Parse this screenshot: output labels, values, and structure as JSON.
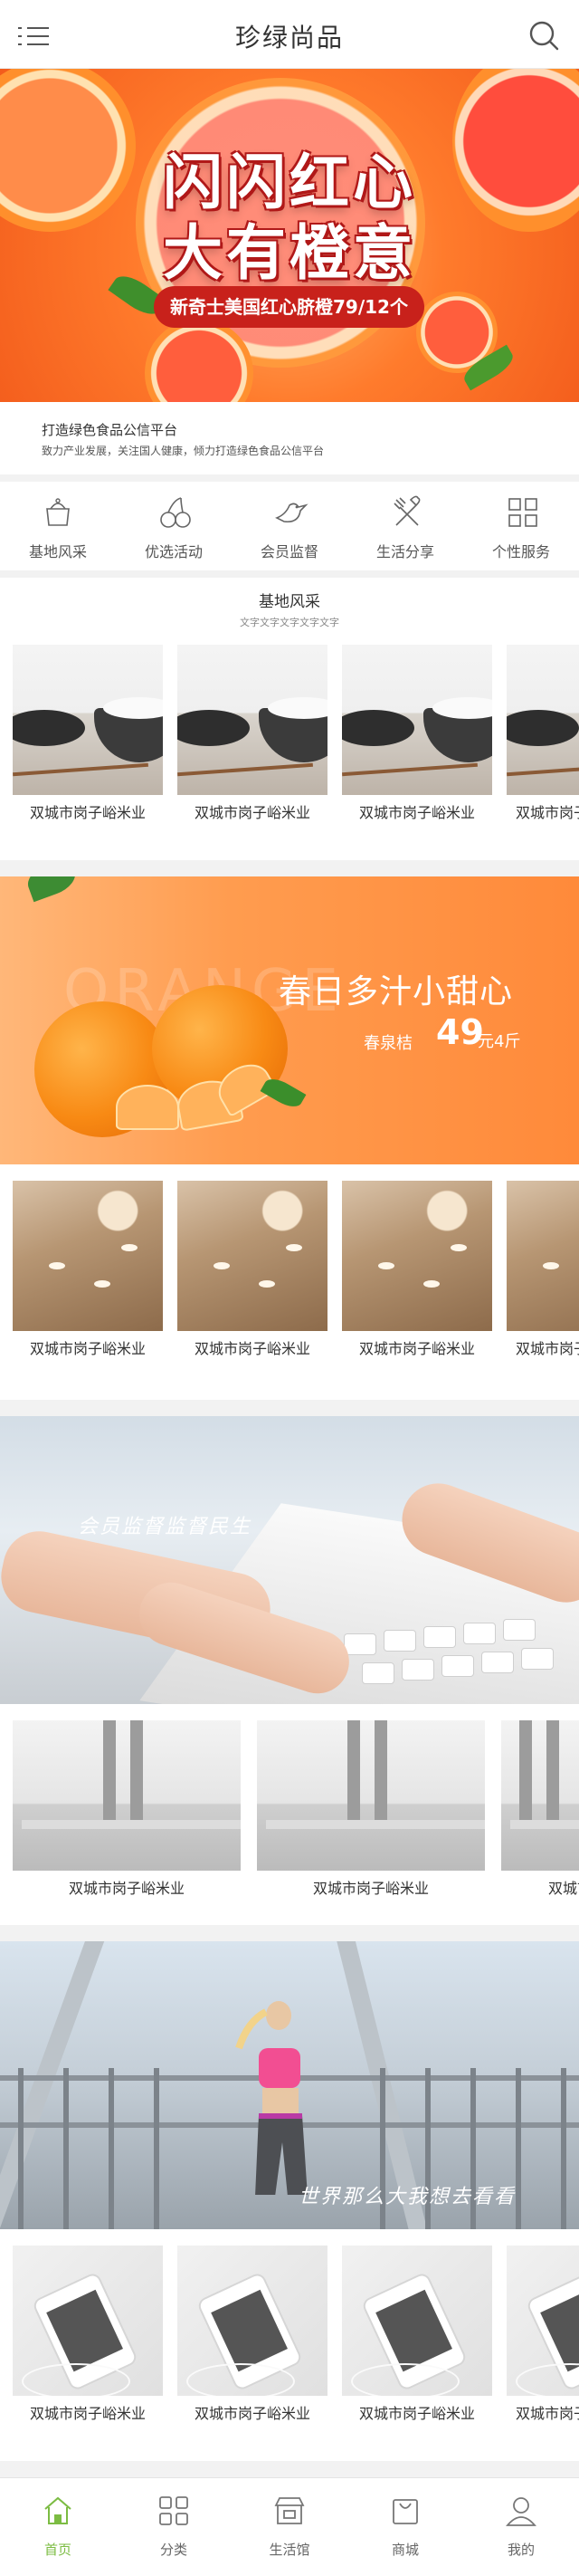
{
  "header": {
    "title": "珍绿尚品"
  },
  "hero": {
    "line1": "闪闪红心",
    "line2": "大有橙意",
    "tag": "新奇士美国红心脐橙79/12个"
  },
  "intro": {
    "title": "打造绿色食品公信平台",
    "subtitle": "致力产业发展，关注国人健康，倾力打造绿色食品公信平台"
  },
  "nav": [
    {
      "label": "基地风采",
      "icon": "pot-icon"
    },
    {
      "label": "优选活动",
      "icon": "cherry-icon"
    },
    {
      "label": "会员监督",
      "icon": "bird-icon"
    },
    {
      "label": "生活分享",
      "icon": "utensils-icon"
    },
    {
      "label": "个性服务",
      "icon": "grid-icon"
    }
  ],
  "section1": {
    "title": "基地风采",
    "subtitle": "文字文字文字文字文字",
    "items": [
      "双城市岗子峪米业",
      "双城市岗子峪米业",
      "双城市岗子峪米业",
      "双城市岗子峪米业"
    ]
  },
  "banner2": {
    "ghost": "ORANGE",
    "slogan": "春日多汁小甜心",
    "product": "春泉桔",
    "price": "49",
    "unit": "元4斤"
  },
  "section2": {
    "items": [
      "双城市岗子峪米业",
      "双城市岗子峪米业",
      "双城市岗子峪米业",
      "双城市岗子峪米业"
    ]
  },
  "banner3": {
    "text": "会员监督监督民生"
  },
  "section3": {
    "items": [
      "双城市岗子峪米业",
      "双城市岗子峪米业",
      "双城市岗子峪米业"
    ]
  },
  "banner4": {
    "text": "世界那么大我想去看看"
  },
  "section4": {
    "items": [
      "双城市岗子峪米业",
      "双城市岗子峪米业",
      "双城市岗子峪米业",
      "双城市岗子峪米业"
    ]
  },
  "tabbar": [
    {
      "label": "首页",
      "icon": "home-icon",
      "active": true
    },
    {
      "label": "分类",
      "icon": "category-icon",
      "active": false
    },
    {
      "label": "生活馆",
      "icon": "store-icon",
      "active": false
    },
    {
      "label": "商城",
      "icon": "bag-icon",
      "active": false
    },
    {
      "label": "我的",
      "icon": "user-icon",
      "active": false
    }
  ],
  "colors": {
    "accent": "#7cbc43",
    "orange": "#ff8a3a",
    "text": "#333333"
  }
}
